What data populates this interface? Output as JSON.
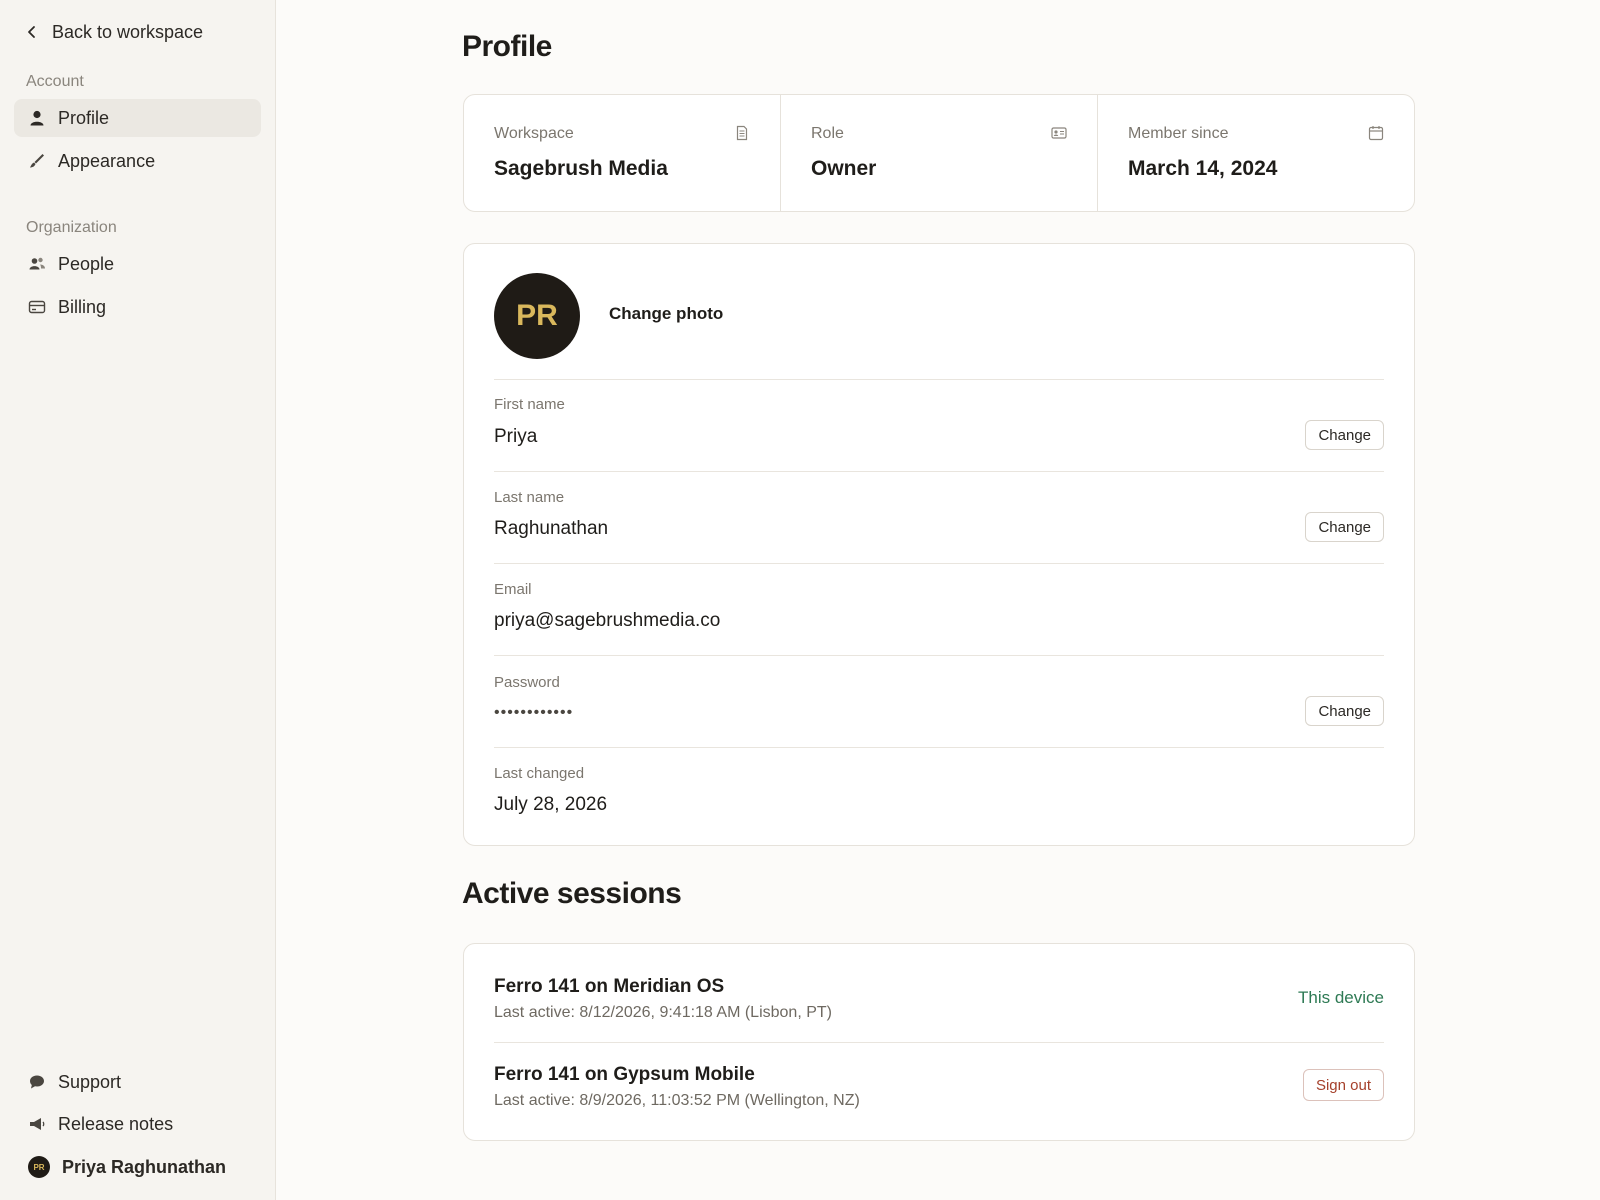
{
  "sidebar": {
    "back_label": "Back to workspace",
    "groups": [
      {
        "label": "Account",
        "items": [
          {
            "label": "Profile",
            "icon": "user-icon",
            "active": true
          },
          {
            "label": "Appearance",
            "icon": "brush-icon"
          }
        ]
      },
      {
        "label": "Organization",
        "items": [
          {
            "label": "People",
            "icon": "people-icon"
          },
          {
            "label": "Billing",
            "icon": "credit-card-icon"
          }
        ]
      }
    ],
    "footer": {
      "support": "Support",
      "release_notes": "Release notes",
      "user_name": "Priya Raghunathan",
      "user_initials": "PR"
    }
  },
  "main": {
    "title": "Profile",
    "stats": [
      {
        "label": "Workspace",
        "value": "Sagebrush Media",
        "icon": "document-icon"
      },
      {
        "label": "Role",
        "value": "Owner",
        "icon": "id-card-icon"
      },
      {
        "label": "Member since",
        "value": "March 14, 2024",
        "icon": "calendar-icon"
      }
    ],
    "profile": {
      "initials": "PR",
      "change_photo": "Change photo",
      "change_label": "Change",
      "fields": {
        "first_name": {
          "label": "First name",
          "value": "Priya"
        },
        "last_name": {
          "label": "Last name",
          "value": "Raghunathan"
        },
        "email": {
          "label": "Email",
          "value": "priya@sagebrushmedia.co"
        },
        "password": {
          "label": "Password",
          "value": "••••••••••••"
        },
        "last_changed": {
          "label": "Last changed",
          "value": "July 28, 2026"
        }
      }
    },
    "sessions": {
      "title": "Active sessions",
      "items": [
        {
          "name": "Ferro 141 on Meridian OS",
          "meta": "Last active: 8/12/2026, 9:41:18 AM (Lisbon, PT)",
          "action": "This device"
        },
        {
          "name": "Ferro 141 on Gypsum Mobile",
          "meta": "Last active: 8/9/2026, 11:03:52 PM (Wellington, NZ)",
          "action": "Sign out"
        }
      ]
    }
  },
  "colors": {
    "accent_green": "#2e7a54",
    "danger_red": "#a5402b",
    "avatar_bg": "#1f1b16",
    "avatar_text": "#d9b85c"
  }
}
